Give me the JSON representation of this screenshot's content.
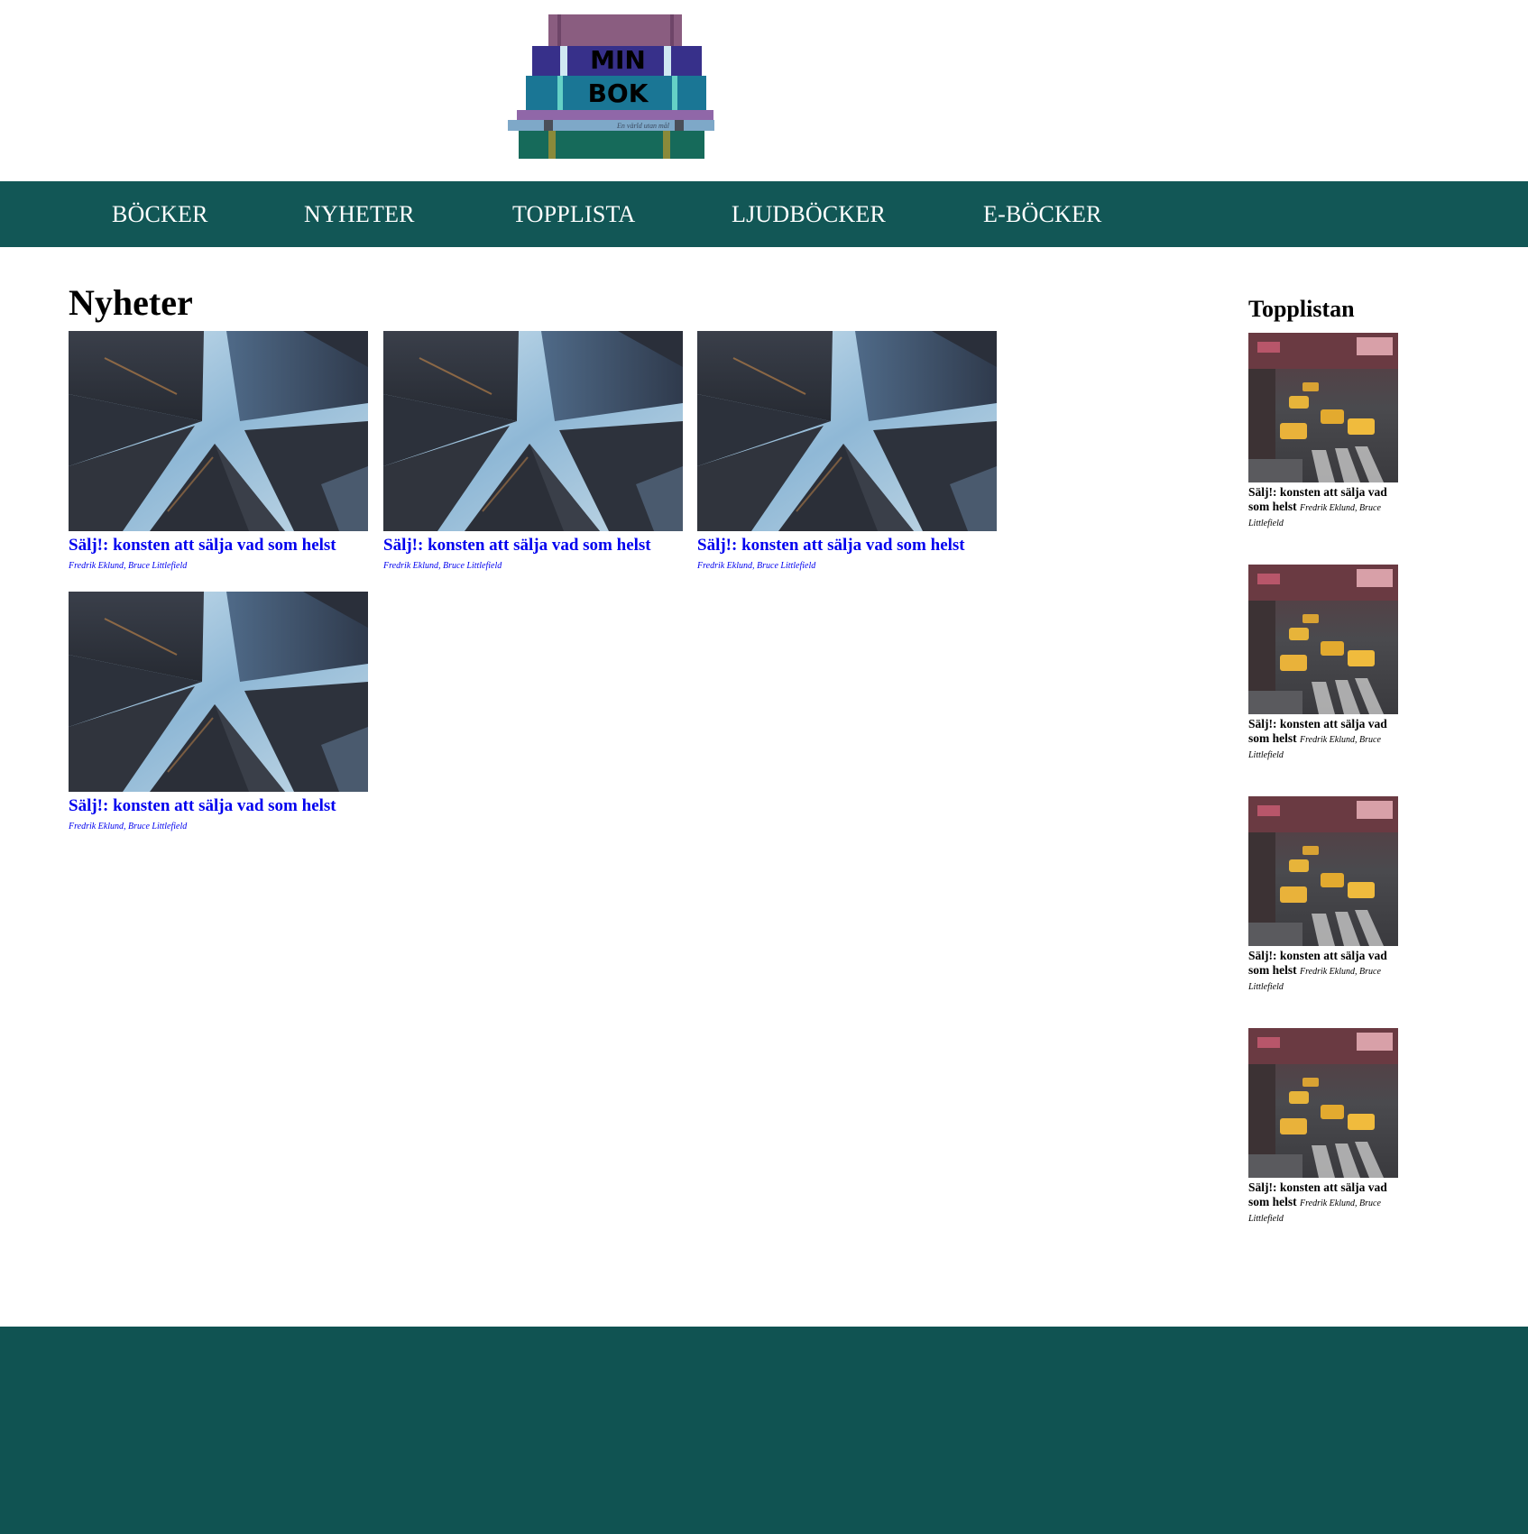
{
  "logo": {
    "line1": "MIN",
    "line2": "BOK",
    "tagline": "En värld utan mål"
  },
  "nav": {
    "items": [
      {
        "label": "BÖCKER"
      },
      {
        "label": "NYHETER"
      },
      {
        "label": "TOPPLISTA"
      },
      {
        "label": "LJUDBÖCKER"
      },
      {
        "label": "E-BÖCKER"
      }
    ]
  },
  "main": {
    "title": "Nyheter",
    "books": [
      {
        "title": "Sälj!: konsten att sälja vad som helst",
        "authors": "Fredrik Eklund, Bruce Littlefield"
      },
      {
        "title": "Sälj!: konsten att sälja vad som helst",
        "authors": "Fredrik Eklund, Bruce Littlefield"
      },
      {
        "title": "Sälj!: konsten att sälja vad som helst",
        "authors": "Fredrik Eklund, Bruce Littlefield"
      },
      {
        "title": "Sälj!: konsten att sälja vad som helst",
        "authors": "Fredrik Eklund, Bruce Littlefield"
      }
    ]
  },
  "sidebar": {
    "title": "Topplistan",
    "items": [
      {
        "title": "Sälj!: konsten att sälja vad som helst",
        "authors": "Fredrik Eklund, Bruce Littlefield"
      },
      {
        "title": "Sälj!: konsten att sälja vad som helst",
        "authors": "Fredrik Eklund, Bruce Littlefield"
      },
      {
        "title": "Sälj!: konsten att sälja vad som helst",
        "authors": "Fredrik Eklund, Bruce Littlefield"
      },
      {
        "title": "Sälj!: konsten att sälja vad som helst",
        "authors": "Fredrik Eklund, Bruce Littlefield"
      }
    ]
  },
  "colors": {
    "brand": "#125756",
    "link": "#0000ee",
    "footer": "#105352"
  }
}
